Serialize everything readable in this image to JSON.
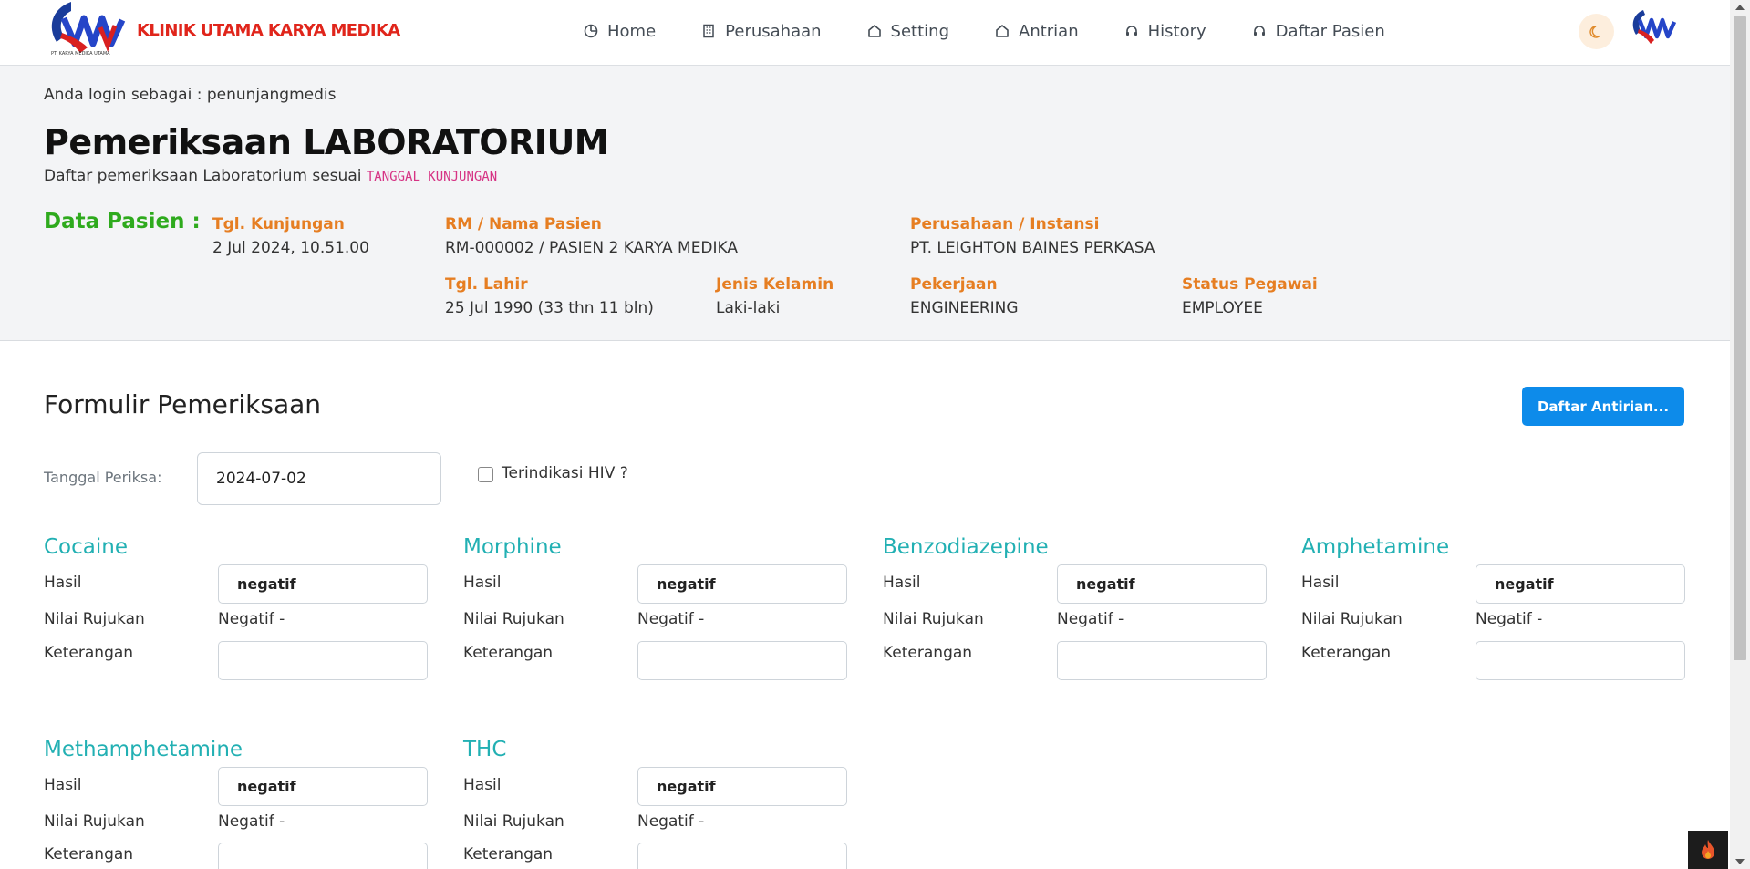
{
  "brand": {
    "name": "KLINIK UTAMA KARYA MEDIKA",
    "logo_caption": "PT. KARYA MEDIKA UTAMA"
  },
  "nav": {
    "items": [
      {
        "label": "Home",
        "icon": "pie-chart-icon"
      },
      {
        "label": "Perusahaan",
        "icon": "building-icon"
      },
      {
        "label": "Setting",
        "icon": "home-icon"
      },
      {
        "label": "Antrian",
        "icon": "home-icon"
      },
      {
        "label": "History",
        "icon": "headset-icon"
      },
      {
        "label": "Daftar Pasien",
        "icon": "headset-icon"
      }
    ],
    "theme_icon": "moon-icon"
  },
  "header": {
    "login_info": "Anda login sebagai : penunjangmedis",
    "title": "Pemeriksaan LABORATORIUM",
    "subtitle": "Daftar pemeriksaan Laboratorium sesuai",
    "subtitle_code": "TANGGAL KUNJUNGAN"
  },
  "patient": {
    "section_label": "Data Pasien :",
    "tgl_kunjungan": {
      "label": "Tgl. Kunjungan",
      "value": "2 Jul 2024, 10.51.00"
    },
    "rm_nama": {
      "label": "RM / Nama Pasien",
      "value": "RM-000002 / PASIEN 2 KARYA MEDIKA"
    },
    "perusahaan": {
      "label": "Perusahaan / Instansi",
      "value": "PT. LEIGHTON BAINES PERKASA"
    },
    "tgl_lahir": {
      "label": "Tgl. Lahir",
      "value": "25 Jul 1990 (33 thn 11 bln)"
    },
    "jenis_kelamin": {
      "label": "Jenis Kelamin",
      "value": "Laki-laki"
    },
    "pekerjaan": {
      "label": "Pekerjaan",
      "value": "ENGINEERING"
    },
    "status_pegawai": {
      "label": "Status Pegawai",
      "value": "EMPLOYEE"
    }
  },
  "form": {
    "title": "Formulir Pemeriksaan",
    "queue_button": "Daftar Antirian...",
    "tanggal_label": "Tanggal Periksa:",
    "tanggal_value": "2024-07-02",
    "hiv_label": "Terindikasi HIV ?",
    "row_labels": {
      "hasil": "Hasil",
      "rujukan": "Nilai Rujukan",
      "keterangan": "Keterangan"
    },
    "tests": [
      {
        "name": "Cocaine",
        "hasil": "negatif",
        "rujukan": "Negatif -",
        "keterangan": ""
      },
      {
        "name": "Morphine",
        "hasil": "negatif",
        "rujukan": "Negatif -",
        "keterangan": ""
      },
      {
        "name": "Benzodiazepine",
        "hasil": "negatif",
        "rujukan": "Negatif -",
        "keterangan": ""
      },
      {
        "name": "Amphetamine",
        "hasil": "negatif",
        "rujukan": "Negatif -",
        "keterangan": ""
      },
      {
        "name": "Methamphetamine",
        "hasil": "negatif",
        "rujukan": "Negatif -",
        "keterangan": ""
      },
      {
        "name": "THC",
        "hasil": "negatif",
        "rujukan": "Negatif -",
        "keterangan": ""
      }
    ]
  },
  "colors": {
    "brand": "#e0251b",
    "accent": "#e67e22",
    "test_name": "#22b0b3",
    "primary_button": "#0d8bea",
    "data_pasien": "#2eaa1d"
  },
  "widget": {
    "icon": "flame-icon"
  }
}
